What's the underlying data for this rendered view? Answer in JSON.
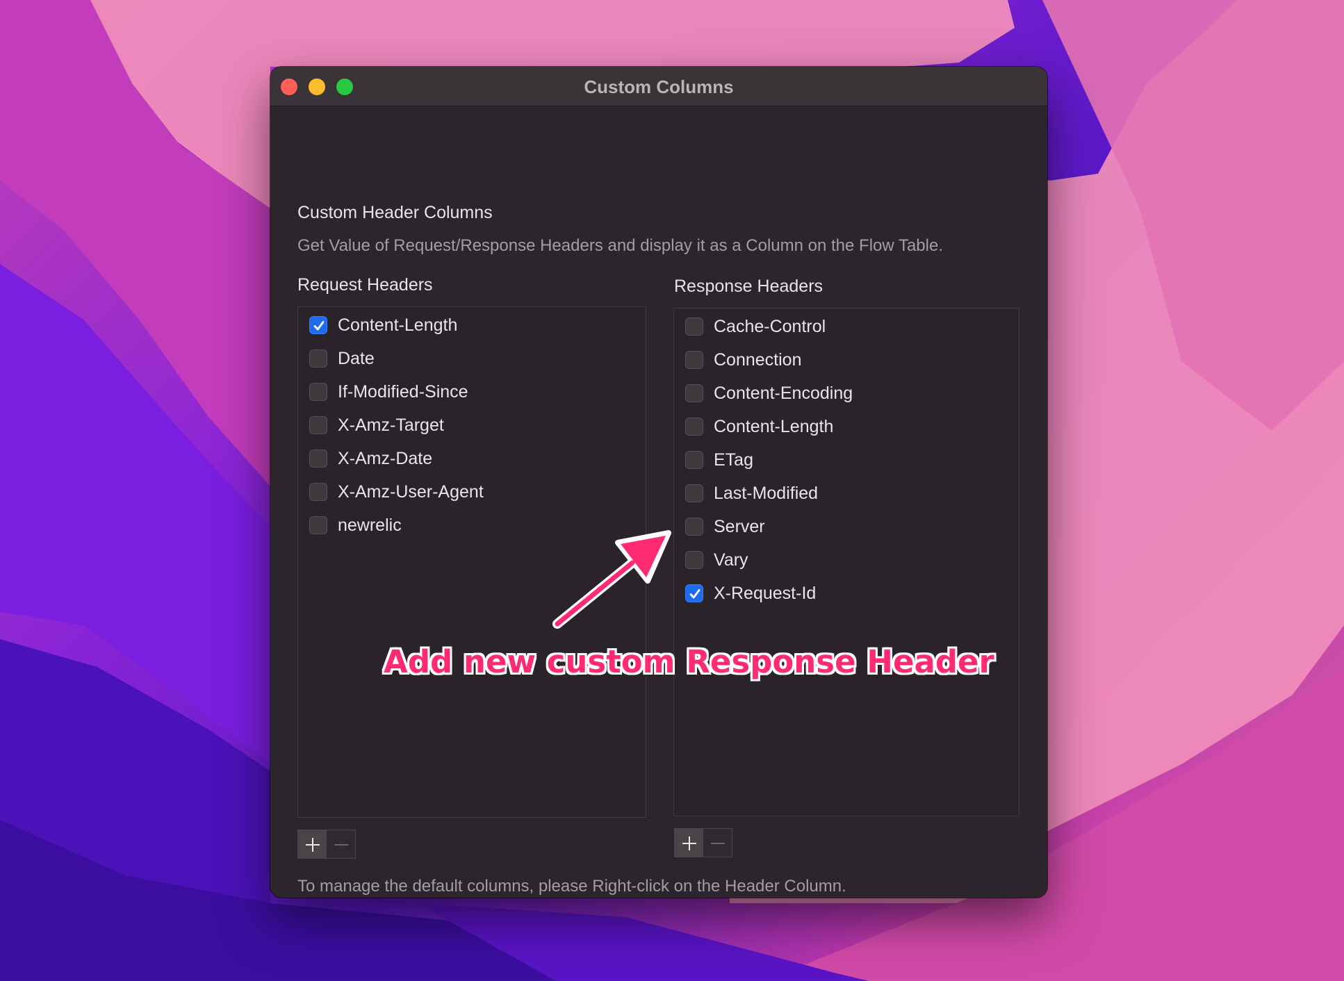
{
  "window": {
    "title": "Custom Columns"
  },
  "section": {
    "title": "Custom Header Columns",
    "description": "Get Value of Request/Response Headers and display it as a Column on the Flow Table."
  },
  "request": {
    "label": "Request Headers",
    "items": [
      {
        "label": "Content-Length",
        "checked": true
      },
      {
        "label": "Date",
        "checked": false
      },
      {
        "label": "If-Modified-Since",
        "checked": false
      },
      {
        "label": "X-Amz-Target",
        "checked": false
      },
      {
        "label": "X-Amz-Date",
        "checked": false
      },
      {
        "label": "X-Amz-User-Agent",
        "checked": false
      },
      {
        "label": "newrelic",
        "checked": false
      }
    ]
  },
  "response": {
    "label": "Response Headers",
    "items": [
      {
        "label": "Cache-Control",
        "checked": false
      },
      {
        "label": "Connection",
        "checked": false
      },
      {
        "label": "Content-Encoding",
        "checked": false
      },
      {
        "label": "Content-Length",
        "checked": false
      },
      {
        "label": "ETag",
        "checked": false
      },
      {
        "label": "Last-Modified",
        "checked": false
      },
      {
        "label": "Server",
        "checked": false
      },
      {
        "label": "Vary",
        "checked": false
      },
      {
        "label": "X-Request-Id",
        "checked": true
      }
    ]
  },
  "footer": {
    "text": "To manage the default columns, please Right-click on the Header Column.",
    "help_label": "?"
  },
  "annotation": {
    "text": "Add new custom Response Header",
    "color": "#ff2a74"
  },
  "colors": {
    "accent": "#1f6bf0",
    "window_bg": "#2c252c"
  }
}
